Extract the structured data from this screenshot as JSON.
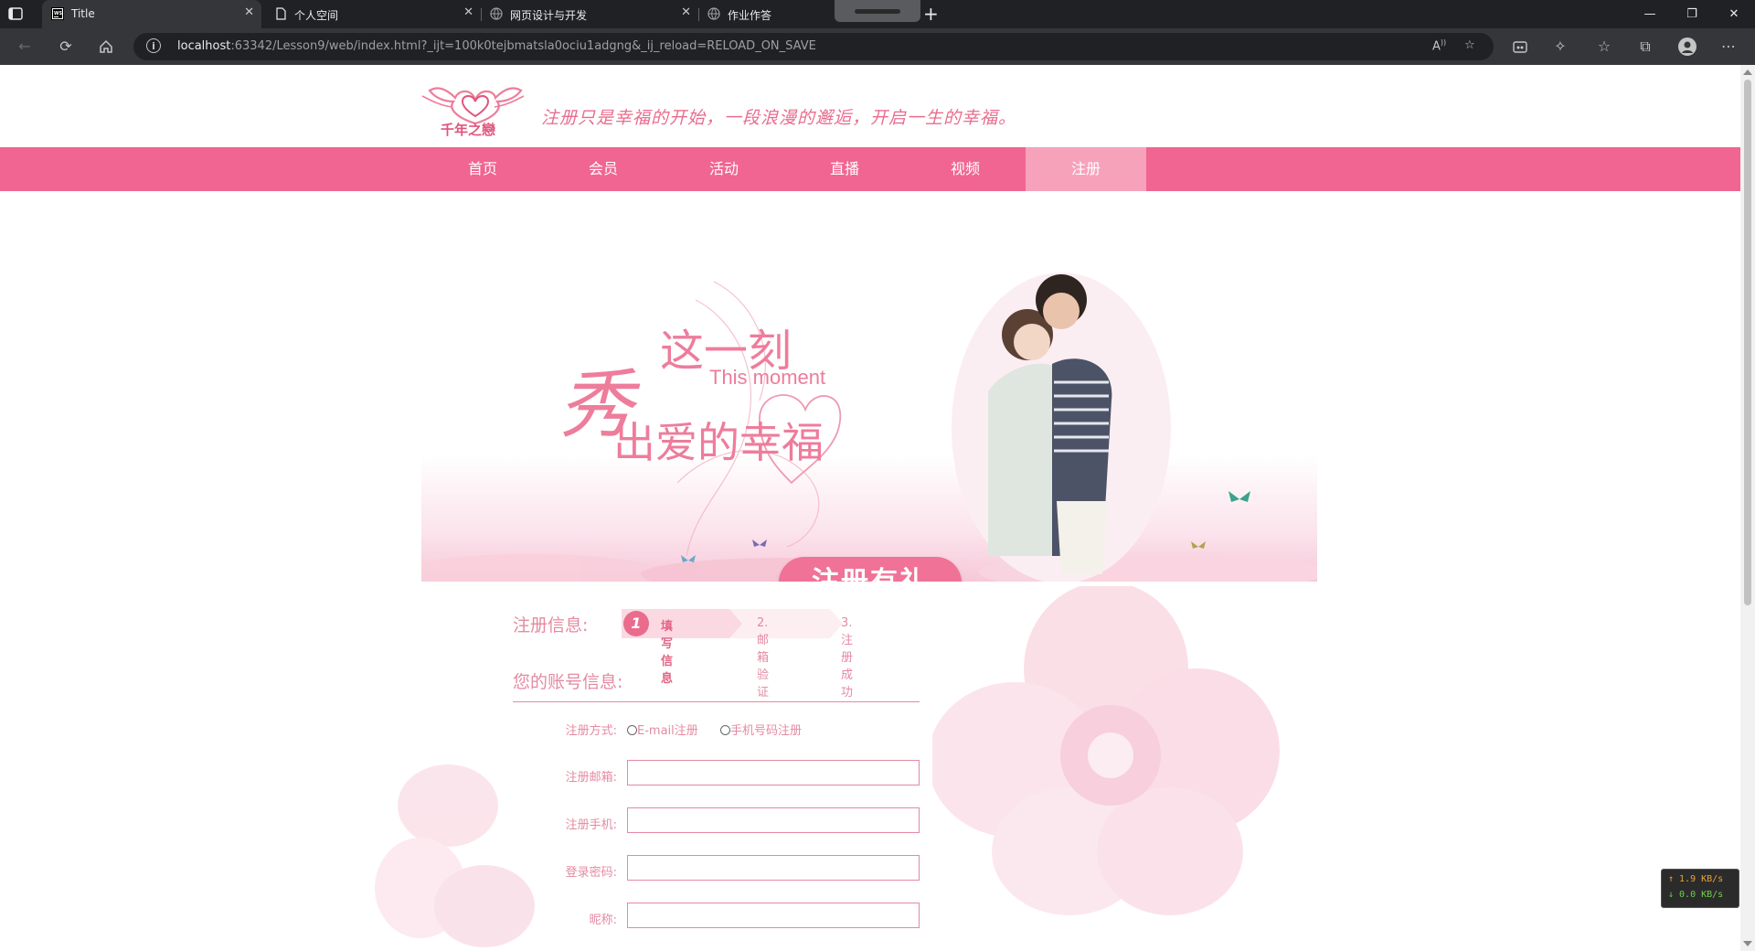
{
  "browser": {
    "tabs": [
      {
        "label": "Title",
        "favicon": "webstorm-icon",
        "active": true
      },
      {
        "label": "个人空间",
        "favicon": "page-icon",
        "active": false
      },
      {
        "label": "网页设计与开发",
        "favicon": "globe-icon",
        "active": false
      },
      {
        "label": "作业作答",
        "favicon": "globe-icon",
        "active": false
      }
    ],
    "close_glyph": "✕",
    "address": {
      "host": "localhost",
      "rest": ":63342/Lesson9/web/index.html?_ijt=100k0tejbmatsla0ociu1adgng&_ij_reload=RELOAD_ON_SAVE"
    }
  },
  "site": {
    "logo_text": "千年之戀",
    "slogan": "注册只是幸福的开始，一段浪漫的邂逅，开启一生的幸福。",
    "nav": [
      {
        "label": "首页",
        "active": false
      },
      {
        "label": "会员",
        "active": false
      },
      {
        "label": "活动",
        "active": false
      },
      {
        "label": "直播",
        "active": false
      },
      {
        "label": "视频",
        "active": false
      },
      {
        "label": "注册",
        "active": true
      }
    ],
    "banner": {
      "xiu": "秀",
      "line1": "这一刻",
      "line2": "This moment",
      "line3": "出爱的幸福",
      "cta": "注册有礼"
    },
    "steps": {
      "label": "注册信息:",
      "step1_num": "1",
      "step1": "填写信息",
      "step2": "2.邮箱验证",
      "step3": "3.注册成功"
    },
    "account": {
      "title": "您的账号信息:",
      "method_label": "注册方式:",
      "method_options": [
        "E-mail注册",
        "手机号码注册"
      ],
      "email_label": "注册邮箱:",
      "phone_label": "注册手机:",
      "password_label": "登录密码:",
      "nickname_label": "昵称:"
    }
  },
  "netspeed": {
    "up": "↑ 1.9 KB/s",
    "down": "↓ 0.0 KB/s"
  },
  "colors": {
    "accent": "#f06591",
    "nav_active": "#f6a2bb",
    "text_pink": "#e48aa2"
  }
}
